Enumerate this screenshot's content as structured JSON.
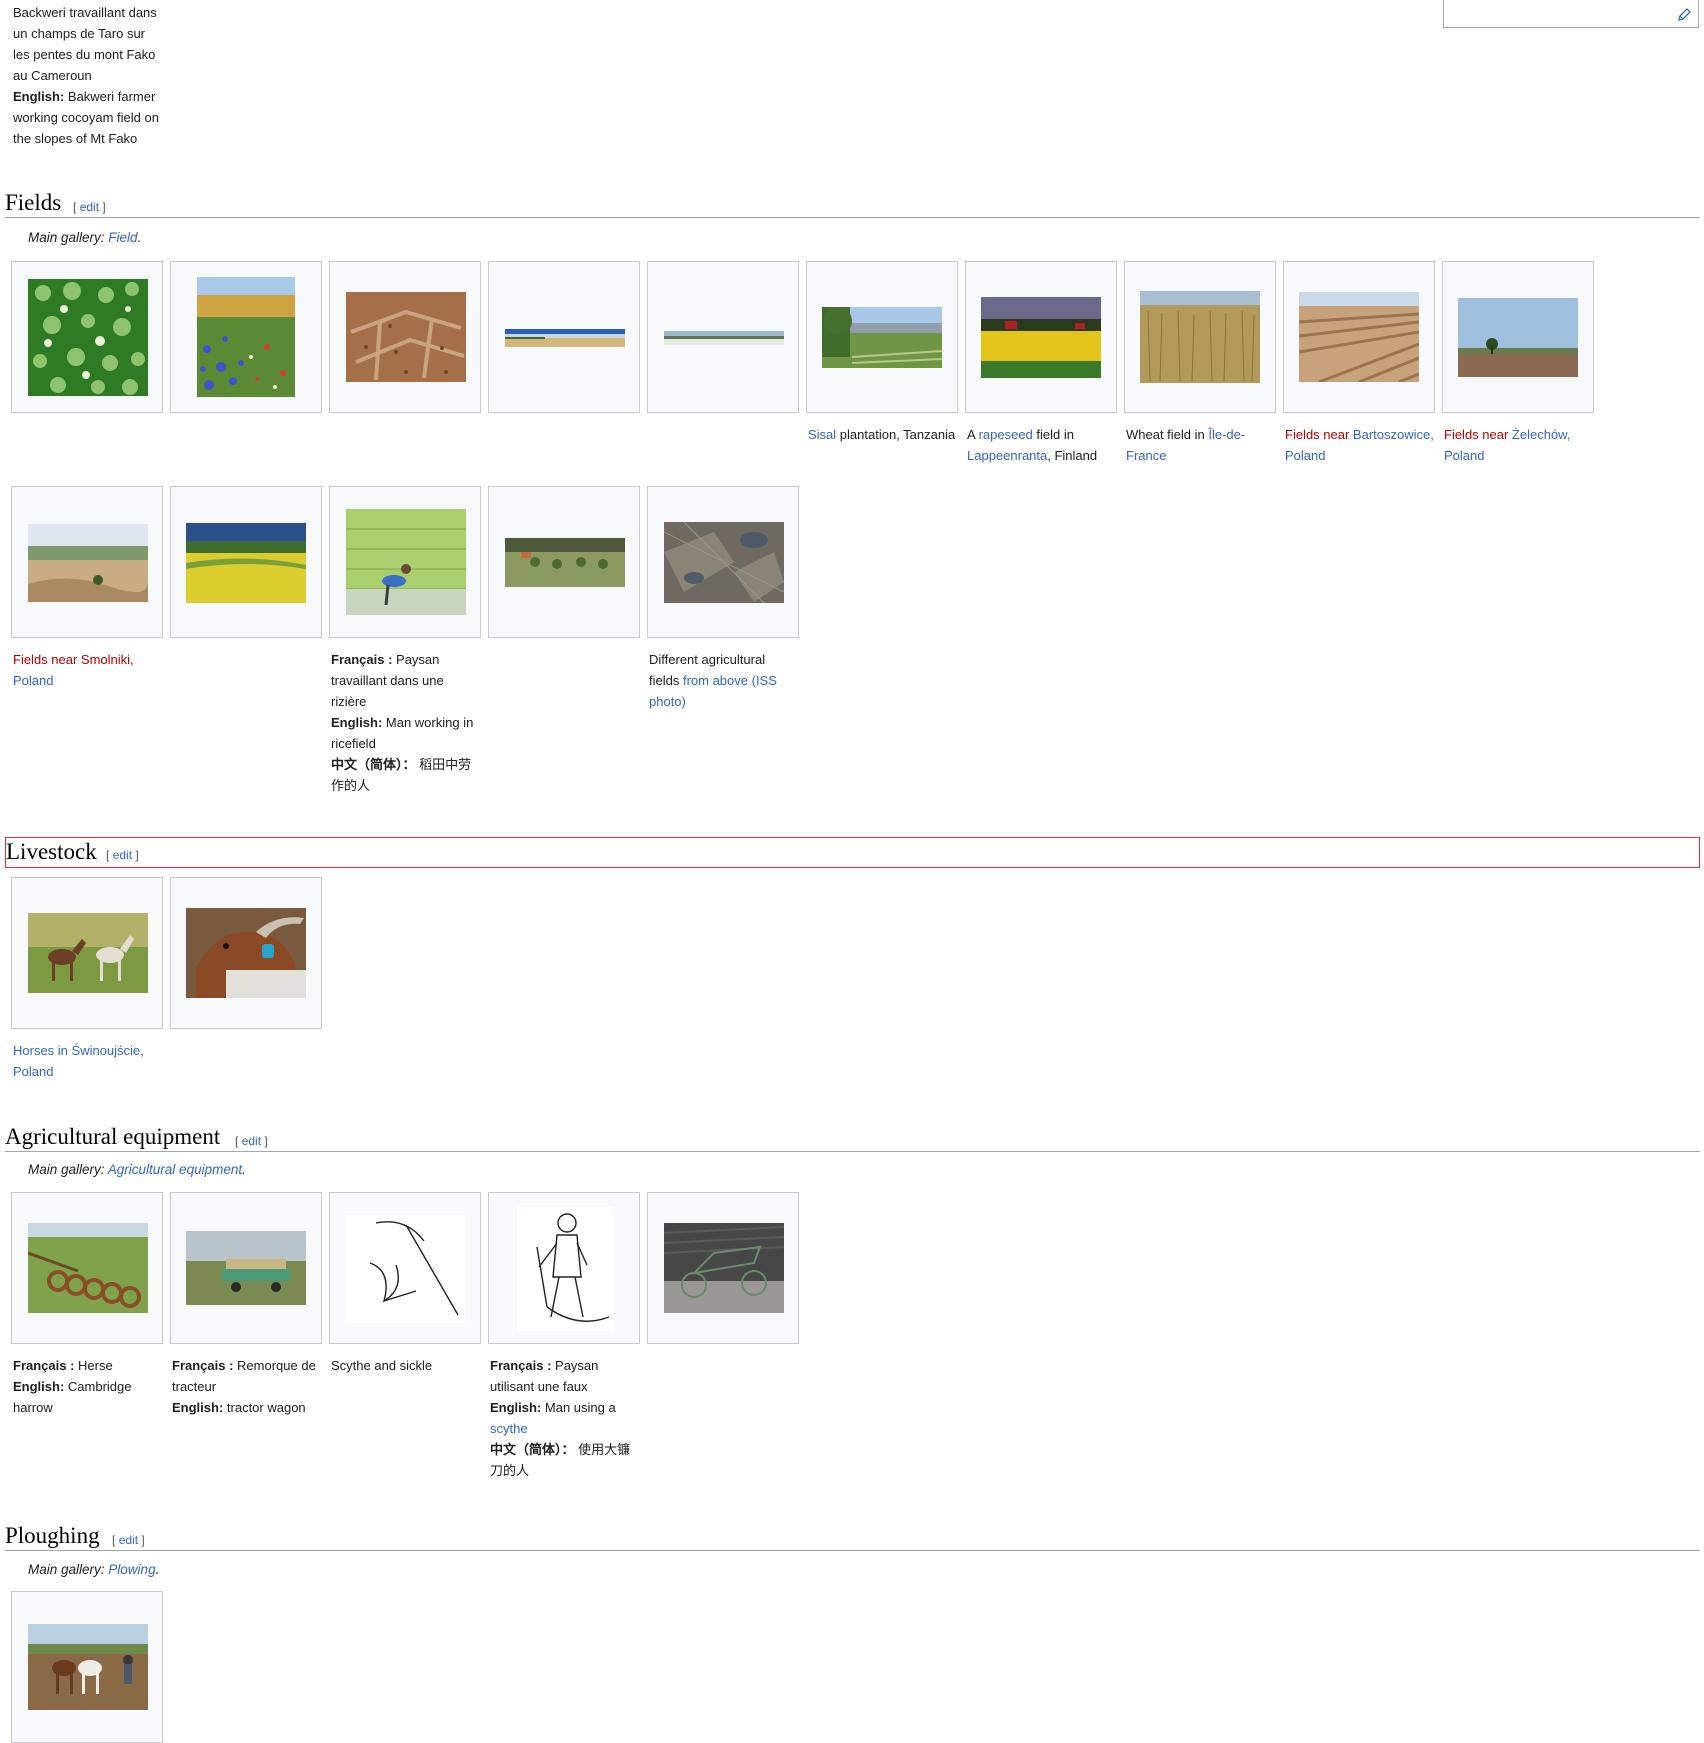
{
  "top_caption": {
    "fr_text": "Backweri travaillant dans un champs de Taro sur les pentes du mont Fako au Cameroun",
    "en_label": "English:",
    "en_text": " Bakweri farmer working cocoyam field on the slopes of Mt Fako"
  },
  "edit_bracket_open": "[",
  "edit_bracket_close": "]",
  "edit_label": "edit",
  "main_gallery_label": "Main gallery: ",
  "sections": {
    "fields": {
      "title": "Fields",
      "main_gallery_link": "Field",
      "captions": {
        "sisal": {
          "link": "Sisal",
          "text": " plantation, Tanzania"
        },
        "rapeseed": {
          "pre": "A ",
          "link1": "rapeseed",
          "mid": " field in ",
          "link2": "Lappeenranta",
          "post": ", Finland"
        },
        "wheat": {
          "pre": "Wheat field in ",
          "link": "Île-de-France"
        },
        "bartoszowice": {
          "red": "Fields near ",
          "link": "Bartoszowice, Poland"
        },
        "zelechow": {
          "red": "Fields near ",
          "link": "Żelechów, Poland"
        },
        "smolniki": {
          "red": "Fields near Smolniki, ",
          "link": "Poland"
        },
        "ricefield": {
          "fr_label": "Français :",
          "fr_text": " Paysan travaillant dans une rizière",
          "en_label": "English:",
          "en_text": " Man working in ricefield",
          "zh_label": "中文（简体）：",
          "zh_text": " 稻田中劳作的人"
        },
        "iss": {
          "pre": "Different agricultural fields ",
          "link": "from above (ISS photo)"
        }
      }
    },
    "livestock": {
      "title": "Livestock",
      "captions": {
        "horses": {
          "link": "Horses in Świnoujście, Poland"
        }
      }
    },
    "equipment": {
      "title": "Agricultural equipment",
      "main_gallery_link": "Agricultural equipment",
      "captions": {
        "harrow": {
          "fr_label": "Français :",
          "fr_text": " Herse",
          "en_label": "English:",
          "en_text": " Cambridge harrow"
        },
        "wagon": {
          "fr_label": "Français :",
          "fr_text": " Remorque de tracteur",
          "en_label": "English:",
          "en_text": " tractor wagon"
        },
        "scythe_sickle": {
          "text": "Scythe and sickle"
        },
        "man_scythe": {
          "fr_label": "Français :",
          "fr_text": " Paysan utilisant une faux",
          "en_label": "English:",
          "en_text": " Man using a ",
          "en_link": "scythe",
          "zh_label": "中文（简体）：",
          "zh_text": " 使用大镰刀的人"
        }
      }
    },
    "ploughing": {
      "title": "Ploughing",
      "main_gallery_link": "Plowing"
    }
  },
  "colors": {
    "link": "#3366cc",
    "redlink": "#ba0000",
    "frame_border": "#c8ccd1",
    "frame_bg": "#f8f9fa",
    "selection": "#e03030"
  }
}
